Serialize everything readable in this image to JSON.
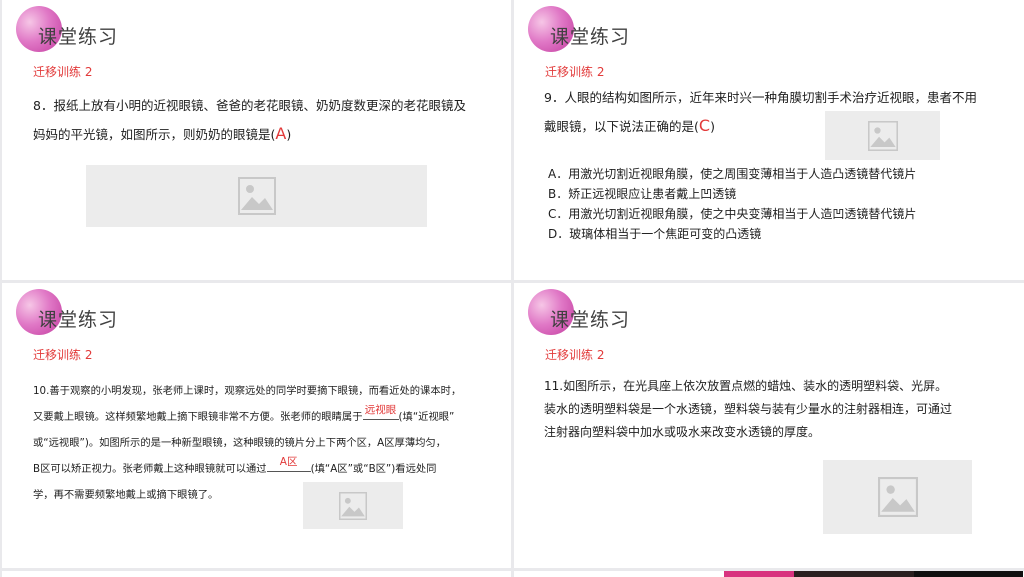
{
  "slides": [
    {
      "title": "课堂练习",
      "subtitle": "迁移训练 2",
      "question_line1": "8．报纸上放有小明的近视眼镜、爸爸的老花眼镜、奶奶度数更深的老花眼镜及",
      "question_line2": "妈妈的平光镜，如图所示，则奶奶的眼镜是(",
      "answer": "A",
      "question_end": ")",
      "image_icon": "image-placeholder-icon"
    },
    {
      "title": "课堂练习",
      "subtitle": "迁移训练 2",
      "question_line1": "9．人眼的结构如图所示，近年来时兴一种角膜切割手术治疗近视眼，患者不用",
      "question_line2": "戴眼镜，以下说法正确的是(",
      "answer": "C",
      "question_end": ")",
      "options": [
        "A．用激光切割近视眼角膜，使之周围变薄相当于人造凸透镜替代镜片",
        "B．矫正远视眼应让患者戴上凹透镜",
        "C．用激光切割近视眼角膜，使之中央变薄相当于人造凹透镜替代镜片",
        "D．玻璃体相当于一个焦距可变的凸透镜"
      ],
      "image_icon": "image-placeholder-icon"
    },
    {
      "title": "课堂练习",
      "subtitle": "迁移训练 2",
      "l1": "10.善于观察的小明发现，张老师上课时，观察远处的同学时要摘下眼镜，而看近处的课本时，",
      "l2a": "又要戴上眼镜。这样频繁地戴上摘下眼镜非常不方便。张老师的眼睛属于",
      "blank1": "远视眼",
      "l2b": "(填“近视眼”",
      "l3": "或“远视眼”)。如图所示的是一种新型眼镜，这种眼镜的镜片分上下两个区，A区厚薄均匀，",
      "l4a": "B区可以矫正视力。张老师戴上这种眼镜就可以通过",
      "blank2": "A区",
      "l4b": "(填“A区”或“B区”)看远处同",
      "l5": "学，再不需要频繁地戴上或摘下眼镜了。",
      "image_icon": "image-placeholder-icon"
    },
    {
      "title": "课堂练习",
      "subtitle": "迁移训练 2",
      "l1": "11.如图所示，在光具座上依次放置点燃的蜡烛、装水的透明塑料袋、光屏。",
      "l2": "装水的透明塑料袋是一个水透镜，塑料袋与装有少量水的注射器相连，可通过",
      "l3": "注射器向塑料袋中加水或吸水来改变水透镜的厚度。",
      "image_icon": "image-placeholder-icon"
    }
  ],
  "colors": {
    "accent": "#e23a3a",
    "circle": "#d85fb8",
    "background": "#e9e9ec",
    "image_placeholder": "#ececec"
  }
}
